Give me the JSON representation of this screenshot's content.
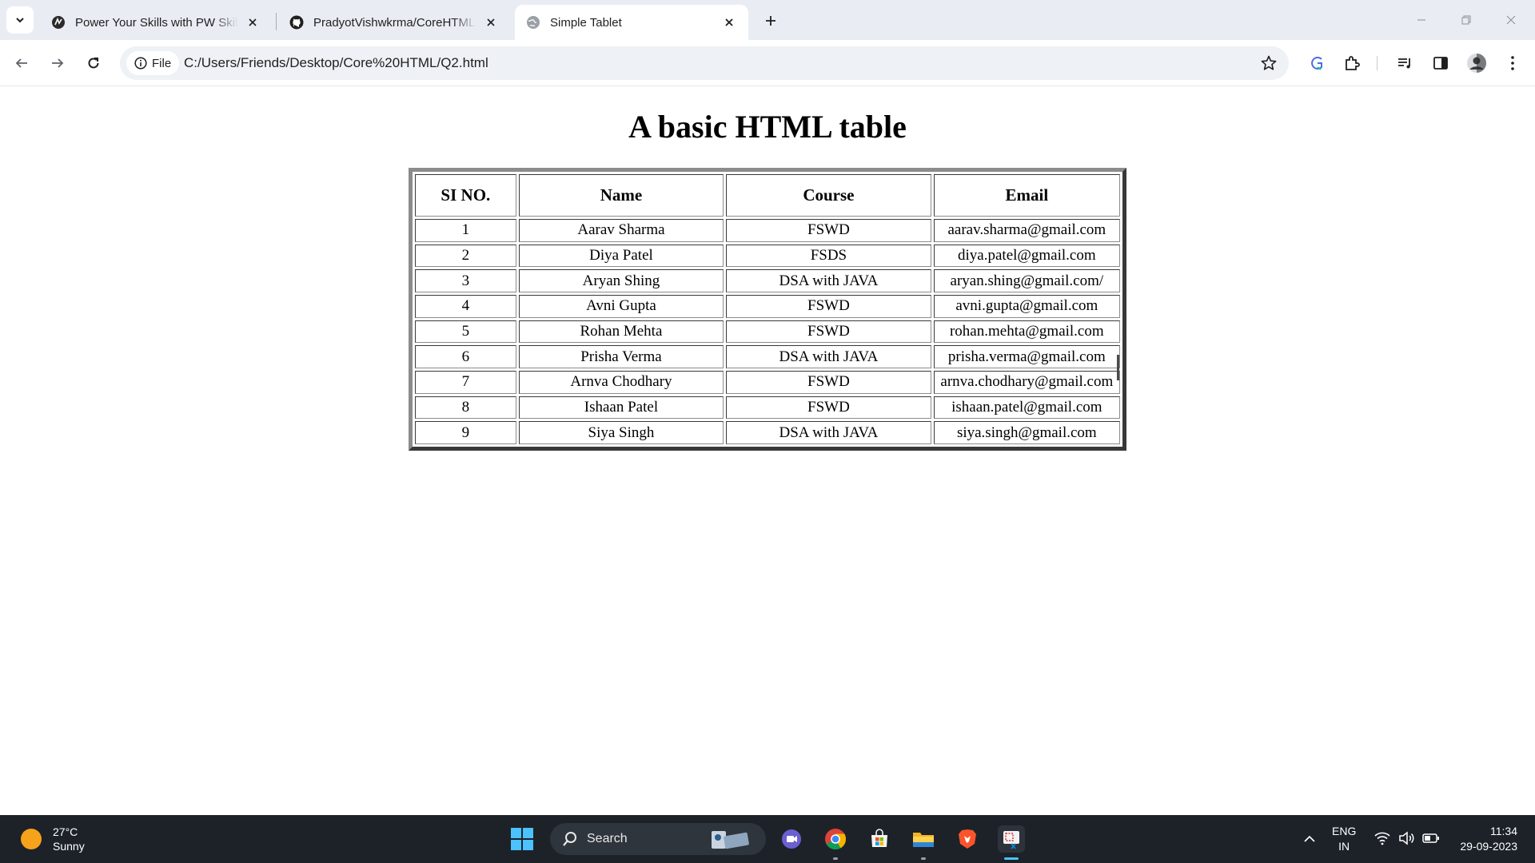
{
  "browser": {
    "tabs": [
      {
        "title": "Power Your Skills with PW Skills",
        "favicon": "pw-skills-icon",
        "active": false
      },
      {
        "title": "PradyotVishwkrma/CoreHTML",
        "favicon": "github-icon",
        "active": false
      },
      {
        "title": "Simple Tablet",
        "favicon": "globe-icon",
        "active": true
      }
    ],
    "address": {
      "chip_label": "File",
      "url": "C:/Users/Friends/Desktop/Core%20HTML/Q2.html"
    }
  },
  "page": {
    "title": "A basic HTML table",
    "table": {
      "headers": [
        "SI NO.",
        "Name",
        "Course",
        "Email"
      ],
      "rows": [
        [
          "1",
          "Aarav Sharma",
          "FSWD",
          "aarav.sharma@gmail.com"
        ],
        [
          "2",
          "Diya Patel",
          "FSDS",
          "diya.patel@gmail.com"
        ],
        [
          "3",
          "Aryan Shing",
          "DSA with JAVA",
          "aryan.shing@gmail.com/"
        ],
        [
          "4",
          "Avni Gupta",
          "FSWD",
          "avni.gupta@gmail.com"
        ],
        [
          "5",
          "Rohan Mehta",
          "FSWD",
          "rohan.mehta@gmail.com"
        ],
        [
          "6",
          "Prisha Verma",
          "DSA with JAVA",
          "prisha.verma@gmail.com"
        ],
        [
          "7",
          "Arnva Chodhary",
          "FSWD",
          "arnva.chodhary@gmail.com"
        ],
        [
          "8",
          "Ishaan Patel",
          "FSWD",
          "ishaan.patel@gmail.com"
        ],
        [
          "9",
          "Siya Singh",
          "DSA with JAVA",
          "siya.singh@gmail.com"
        ]
      ]
    }
  },
  "taskbar": {
    "weather": {
      "temp": "27°C",
      "condition": "Sunny"
    },
    "search_label": "Search",
    "apps": [
      "teams-meet-icon",
      "chrome-icon",
      "microsoft-store-icon",
      "file-explorer-icon",
      "brave-icon",
      "snipping-tool-icon"
    ],
    "language": {
      "line1": "ENG",
      "line2": "IN"
    },
    "clock": {
      "time": "11:34",
      "date": "29-09-2023"
    }
  },
  "colors": {
    "tabstrip": "#e9edf3",
    "taskbar": "#1d2229",
    "accent": "#4cc2ff",
    "table_border": "#8c8c8c"
  }
}
